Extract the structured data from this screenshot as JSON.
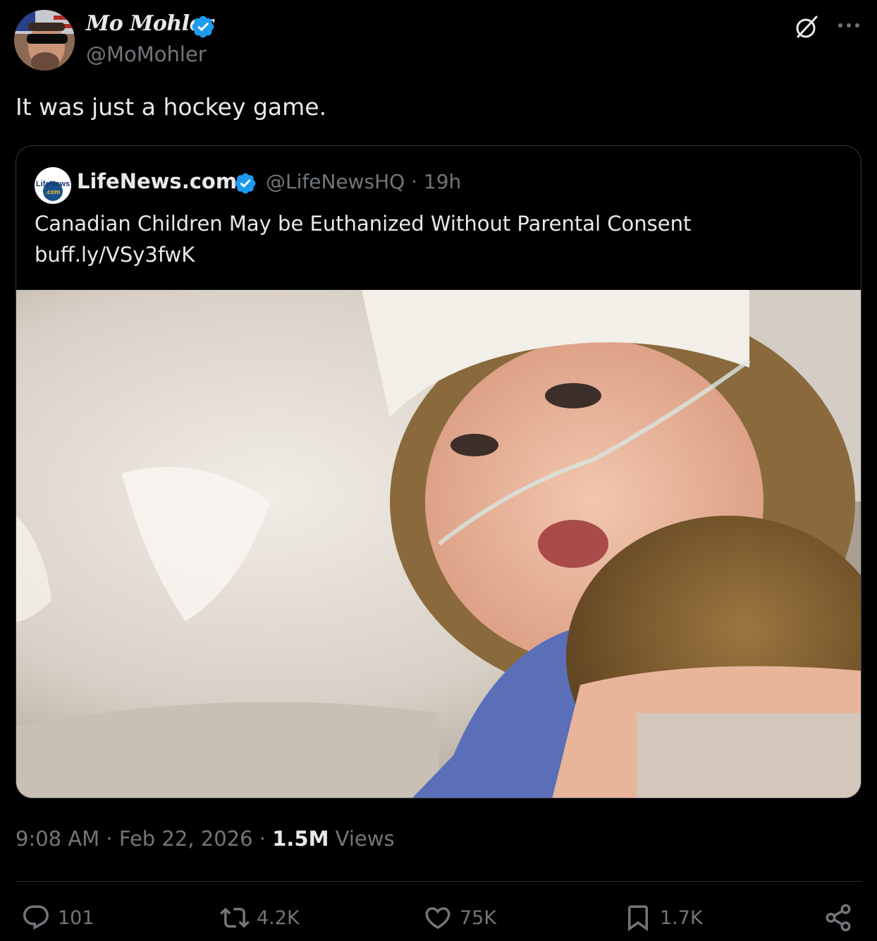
{
  "tweet": {
    "author": {
      "name": "Mo Mohler",
      "handle": "@MoMohler",
      "verified": true,
      "avatar": "profile-photo"
    },
    "text": "It was just a hockey game.",
    "timestamp": "9:08 AM · Feb 22, 2026 · ",
    "views_count": "1.5M",
    "views_label": " Views"
  },
  "quote": {
    "logo_text_top": "LifeNews",
    "logo_text_bottom": ".com",
    "name": "LifeNews.com",
    "verified": true,
    "meta": "@LifeNewsHQ · 19h",
    "text_line1": "Canadian Children May be Euthanized Without Parental Consent",
    "text_line2": "buff.ly/VSy3fwK",
    "image": "photo-child-in-hospital-bed-with-teddy-bear"
  },
  "actions": {
    "replies": "101",
    "reposts": "4.2K",
    "likes": "75K",
    "bookmarks": "1.7K"
  },
  "icons": {
    "header": [
      "grok-icon",
      "more-icon"
    ],
    "actions": [
      "reply-icon",
      "repost-icon",
      "like-icon",
      "bookmark-icon",
      "share-icon"
    ]
  },
  "colors": {
    "background": "#000000",
    "text_primary": "#e7e9ea",
    "text_secondary": "#71767b",
    "verified_blue": "#1d9bf0",
    "border": "#333639"
  }
}
